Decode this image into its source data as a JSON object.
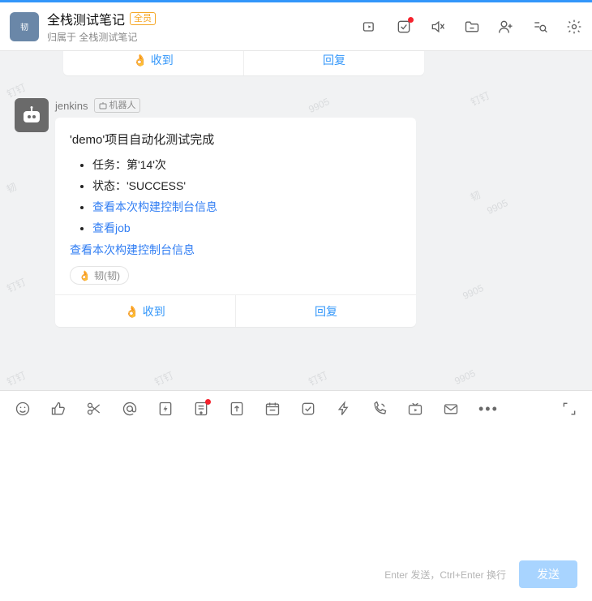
{
  "header": {
    "avatar_text": "韧",
    "title": "全栈测试笔记",
    "badge": "全员",
    "subtitle": "归属于 全栈测试笔记"
  },
  "prev_card": {
    "ack_label": "收到",
    "reply_label": "回复"
  },
  "message": {
    "sender": "jenkins",
    "robot_tag": "机器人",
    "title": "'demo'项目自动化测试完成",
    "items": [
      "任务：第'14'次",
      "状态：'SUCCESS'"
    ],
    "link_items": [
      "查看本次构建控制台信息",
      "查看job"
    ],
    "footer_link": "查看本次构建控制台信息",
    "reaction": "韧(韧)",
    "ack_label": "收到",
    "reply_label": "回复"
  },
  "composer": {
    "hint": "Enter 发送，Ctrl+Enter 换行",
    "send": "发送"
  },
  "watermarks": [
    "钉钉",
    "9905",
    "韧",
    "钉钉",
    "韧",
    "9905",
    "钉钉",
    "9905",
    "钉钉"
  ]
}
